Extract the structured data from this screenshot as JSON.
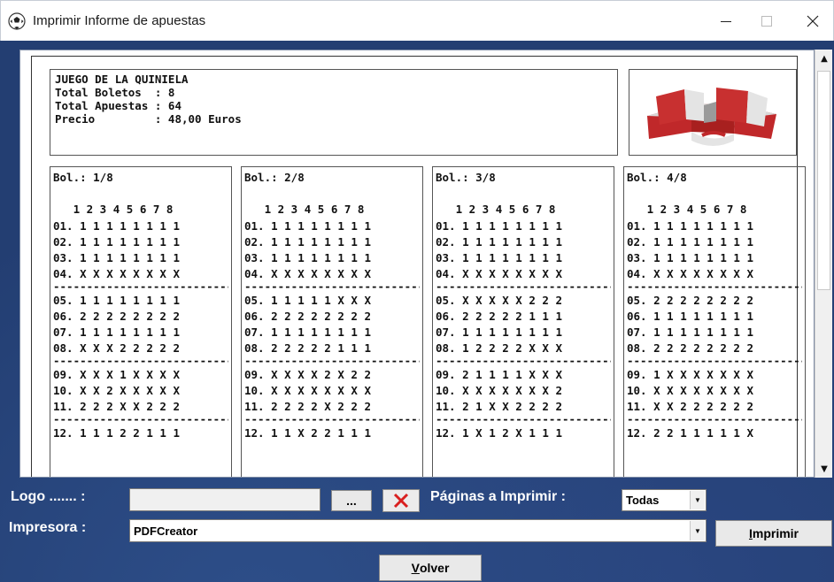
{
  "window": {
    "title": "Imprimir Informe de apuestas",
    "icon": "soccer-ball-icon",
    "minimize_icon": "minimize-icon",
    "maximize_icon": "maximize-icon",
    "close_icon": "close-icon"
  },
  "report": {
    "header_lines": [
      "JUEGO DE LA QUINIELA",
      "Total Boletos  : 8",
      "Total Apuestas : 64",
      "Precio         : 48,00 Euros"
    ],
    "column_header": "   1 2 3 4 5 6 7 8",
    "separator": "------------------------------",
    "tickets": [
      {
        "label": "Bol.: 1/8",
        "rows": [
          "01. 1 1 1 1 1 1 1 1",
          "02. 1 1 1 1 1 1 1 1",
          "03. 1 1 1 1 1 1 1 1",
          "04. X X X X X X X X",
          "05. 1 1 1 1 1 1 1 1",
          "06. 2 2 2 2 2 2 2 2",
          "07. 1 1 1 1 1 1 1 1",
          "08. X X X 2 2 2 2 2",
          "09. X X X 1 X X X X",
          "10. X X 2 X X X X X",
          "11. 2 2 2 X X 2 2 2",
          "12. 1 1 1 2 2 1 1 1"
        ]
      },
      {
        "label": "Bol.: 2/8",
        "rows": [
          "01. 1 1 1 1 1 1 1 1",
          "02. 1 1 1 1 1 1 1 1",
          "03. 1 1 1 1 1 1 1 1",
          "04. X X X X X X X X",
          "05. 1 1 1 1 1 X X X",
          "06. 2 2 2 2 2 2 2 2",
          "07. 1 1 1 1 1 1 1 1",
          "08. 2 2 2 2 2 1 1 1",
          "09. X X X X 2 X 2 2",
          "10. X X X X X X X X",
          "11. 2 2 2 2 X 2 2 2",
          "12. 1 1 X 2 2 1 1 1"
        ]
      },
      {
        "label": "Bol.: 3/8",
        "rows": [
          "01. 1 1 1 1 1 1 1 1",
          "02. 1 1 1 1 1 1 1 1",
          "03. 1 1 1 1 1 1 1 1",
          "04. X X X X X X X X",
          "05. X X X X X 2 2 2",
          "06. 2 2 2 2 2 1 1 1",
          "07. 1 1 1 1 1 1 1 1",
          "08. 1 2 2 2 2 X X X",
          "09. 2 1 1 1 1 X X X",
          "10. X X X X X X X 2",
          "11. 2 1 X X 2 2 2 2",
          "12. 1 X 1 2 X 1 1 1"
        ]
      },
      {
        "label": "Bol.: 4/8",
        "rows": [
          "01. 1 1 1 1 1 1 1 1",
          "02. 1 1 1 1 1 1 1 1",
          "03. 1 1 1 1 1 1 1 1",
          "04. X X X X X X X X",
          "05. 2 2 2 2 2 2 2 2",
          "06. 1 1 1 1 1 1 1 1",
          "07. 1 1 1 1 1 1 1 1",
          "08. 2 2 2 2 2 2 2 2",
          "09. 1 X X X X X X X",
          "10. X X X X X X X X",
          "11. X X 2 2 2 2 2 2",
          "12. 2 2 1 1 1 1 1 X"
        ]
      }
    ]
  },
  "controls": {
    "logo_label": "Logo ....... :",
    "logo_value": "",
    "browse_label": "...",
    "clear_icon": "red-x-icon",
    "pages_label": "Páginas a Imprimir :",
    "pages_value": "Todas",
    "printer_label": "Impresora :",
    "printer_value": "PDFCreator",
    "print_button_u": "I",
    "print_button_rest": "mprimir",
    "back_button_u": "V",
    "back_button_rest": "olver"
  },
  "colors": {
    "background": "#233e72",
    "clear_icon": "#d92020",
    "logo_red": "#c0282a"
  }
}
